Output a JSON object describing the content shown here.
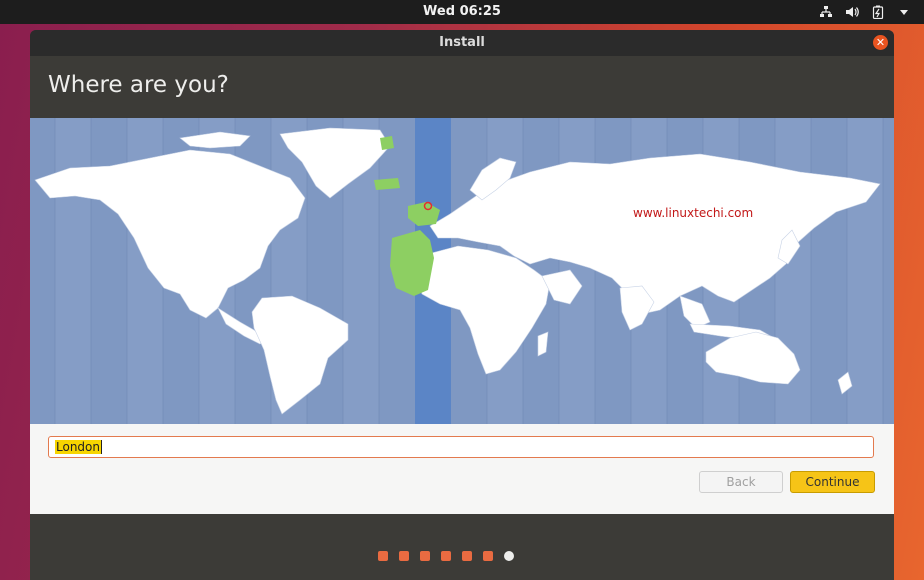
{
  "topbar": {
    "clock": "Wed 06:25"
  },
  "topbar_icons": [
    "network-icon",
    "volume-icon",
    "battery-icon",
    "system-menu-arrow-icon"
  ],
  "window": {
    "title": "Install"
  },
  "page": {
    "heading": "Where are you?"
  },
  "map": {
    "watermark": "www.linuxtechi.com"
  },
  "location": {
    "value": "London"
  },
  "buttons": {
    "back": "Back",
    "continue": "Continue"
  },
  "progress": {
    "total_steps": 7,
    "current_step": 7
  },
  "colors": {
    "accent": "#e95420",
    "continue": "#f6c417",
    "map_water": "#7f98c2",
    "selected_zone": "#5b85c6",
    "highlight_land": "#8dcf62"
  }
}
